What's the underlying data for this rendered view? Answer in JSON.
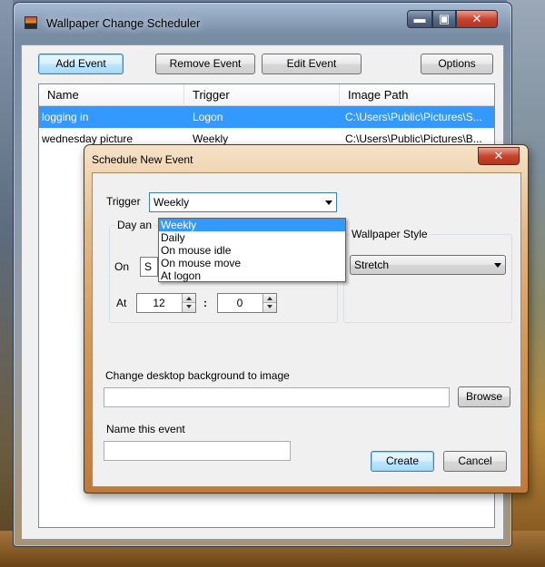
{
  "main_window": {
    "title": "Wallpaper Change Scheduler",
    "controls": {
      "minimize": "▬",
      "maximize": "▣",
      "close": "✕"
    },
    "toolbar": {
      "add_event": "Add Event",
      "remove_event": "Remove Event",
      "edit_event": "Edit Event",
      "options": "Options"
    },
    "table": {
      "columns": [
        "Name",
        "Trigger",
        "Image Path"
      ],
      "rows": [
        {
          "name": "logging in",
          "trigger": "Logon",
          "path": "C:\\Users\\Public\\Pictures\\S..."
        },
        {
          "name": "wednesday picture",
          "trigger": "Weekly",
          "path": "C:\\Users\\Public\\Pictures\\B..."
        }
      ]
    }
  },
  "dialog": {
    "title": "Schedule New Event",
    "close": "✕",
    "trigger_label": "Trigger",
    "trigger_value": "Weekly",
    "trigger_options": [
      "Weekly",
      "Daily",
      "On mouse idle",
      "On mouse move",
      "At logon"
    ],
    "day_group_title": "Day an",
    "on_label": "On",
    "on_value": "S",
    "at_label": "At",
    "hour": "12",
    "time_sep": ":",
    "minute": "0",
    "wallpaper_style_title": "Wallpaper Style",
    "wallpaper_style_value": "Stretch",
    "image_label": "Change desktop background to image",
    "image_path": "",
    "browse": "Browse",
    "name_label": "Name this event",
    "name_value": "",
    "create": "Create",
    "cancel": "Cancel"
  }
}
